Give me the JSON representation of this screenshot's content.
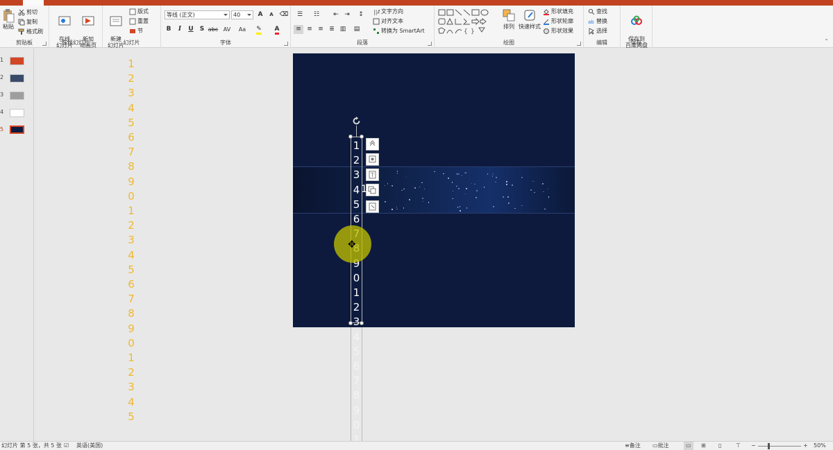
{
  "ribbon": {
    "clipboard": {
      "label": "剪贴板",
      "paste": "粘贴",
      "cut": "剪切",
      "copy": "复制",
      "format_painter": "格式刷"
    },
    "online_slides": {
      "label": "在线幻灯片",
      "online": "在线\n幻灯片",
      "new_anim": "新加\n动画页"
    },
    "slides": {
      "label": "幻灯片",
      "new_slide": "新建\n幻灯片",
      "layout": "版式",
      "reset": "重置",
      "section": "节"
    },
    "font": {
      "label": "字体",
      "font_name": "等线 (正文)",
      "font_size": "40",
      "bold": "B",
      "italic": "I",
      "underline": "U",
      "shadow": "S",
      "strike": "abc",
      "spacing": "AV",
      "case": "Aa",
      "grow": "A",
      "shrink": "A"
    },
    "paragraph": {
      "label": "段落",
      "text_direction": "文字方向",
      "align_text": "对齐文本",
      "convert_smartart": "转换为 SmartArt"
    },
    "drawing": {
      "label": "绘图",
      "arrange": "排列",
      "quick_styles": "快速样式",
      "shape_fill": "形状填充",
      "shape_outline": "形状轮廓",
      "shape_effects": "形状效果"
    },
    "editing": {
      "label": "编辑",
      "find": "查找",
      "replace": "替换",
      "select": "选择"
    },
    "save": {
      "label": "保存",
      "save_to_cloud": "保存到\n百度网盘"
    }
  },
  "thumbnails": [
    {
      "num": "1",
      "color": "#d24726"
    },
    {
      "num": "2",
      "color": "#3a4a6a"
    },
    {
      "num": "3",
      "color": "#9e9e9e"
    },
    {
      "num": "4",
      "color": "#ffffff"
    },
    {
      "num": "5",
      "color": "#0d1a3e"
    }
  ],
  "left_numbers": [
    "1",
    "2",
    "3",
    "4",
    "5",
    "6",
    "7",
    "8",
    "9",
    "0",
    "1",
    "2",
    "3",
    "4",
    "5",
    "6",
    "7",
    "8",
    "9",
    "0",
    "1",
    "2",
    "3",
    "4",
    "5"
  ],
  "textbox_numbers_visible": [
    "1",
    "2",
    "3",
    "4",
    "5",
    "6",
    "7",
    "8",
    "9",
    "0",
    "1",
    "2",
    "3"
  ],
  "textbox_numbers_overflow": [
    "4",
    "5",
    "6",
    "7",
    "8",
    "9",
    "0",
    "1"
  ],
  "slide_overlay_text": "1",
  "status": {
    "slide_info": "幻灯片 第 5 张，共 5 张",
    "language": "英语(美国)",
    "notes": "备注",
    "comments": "批注",
    "zoom": "50%"
  },
  "colors": {
    "accent": "#c1431f",
    "number_yellow": "#f0b82e",
    "slide_bg": "#0d1a3e"
  }
}
